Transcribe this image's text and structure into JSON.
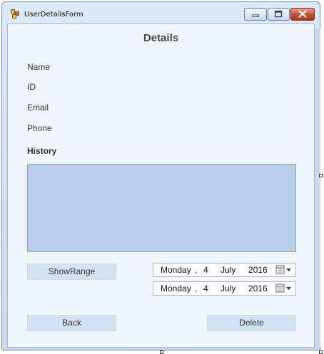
{
  "window": {
    "title": "UserDetailsForm"
  },
  "form": {
    "heading": "Details",
    "labels": {
      "name": "Name",
      "id": "ID",
      "email": "Email",
      "phone": "Phone",
      "history": "History"
    },
    "buttons": {
      "show_range": "ShowRange",
      "back": "Back",
      "delete": "Delete"
    },
    "date_pickers": [
      {
        "weekday": "Monday",
        "separator": ",",
        "day": "4",
        "month": "July",
        "year": "2016"
      },
      {
        "weekday": "Monday",
        "separator": ",",
        "day": "4",
        "month": "July",
        "year": "2016"
      }
    ]
  },
  "icons": {
    "app": "form-app-icon",
    "minimize": "minimize-icon",
    "maximize": "maximize-icon",
    "close": "close-icon",
    "calendar": "calendar-dropdown-icon"
  },
  "colors": {
    "client_background": "#f0f5fc",
    "listbox_background": "#b9d0ec",
    "button_background": "#d2e2f3",
    "close_button": "#c44a32"
  }
}
